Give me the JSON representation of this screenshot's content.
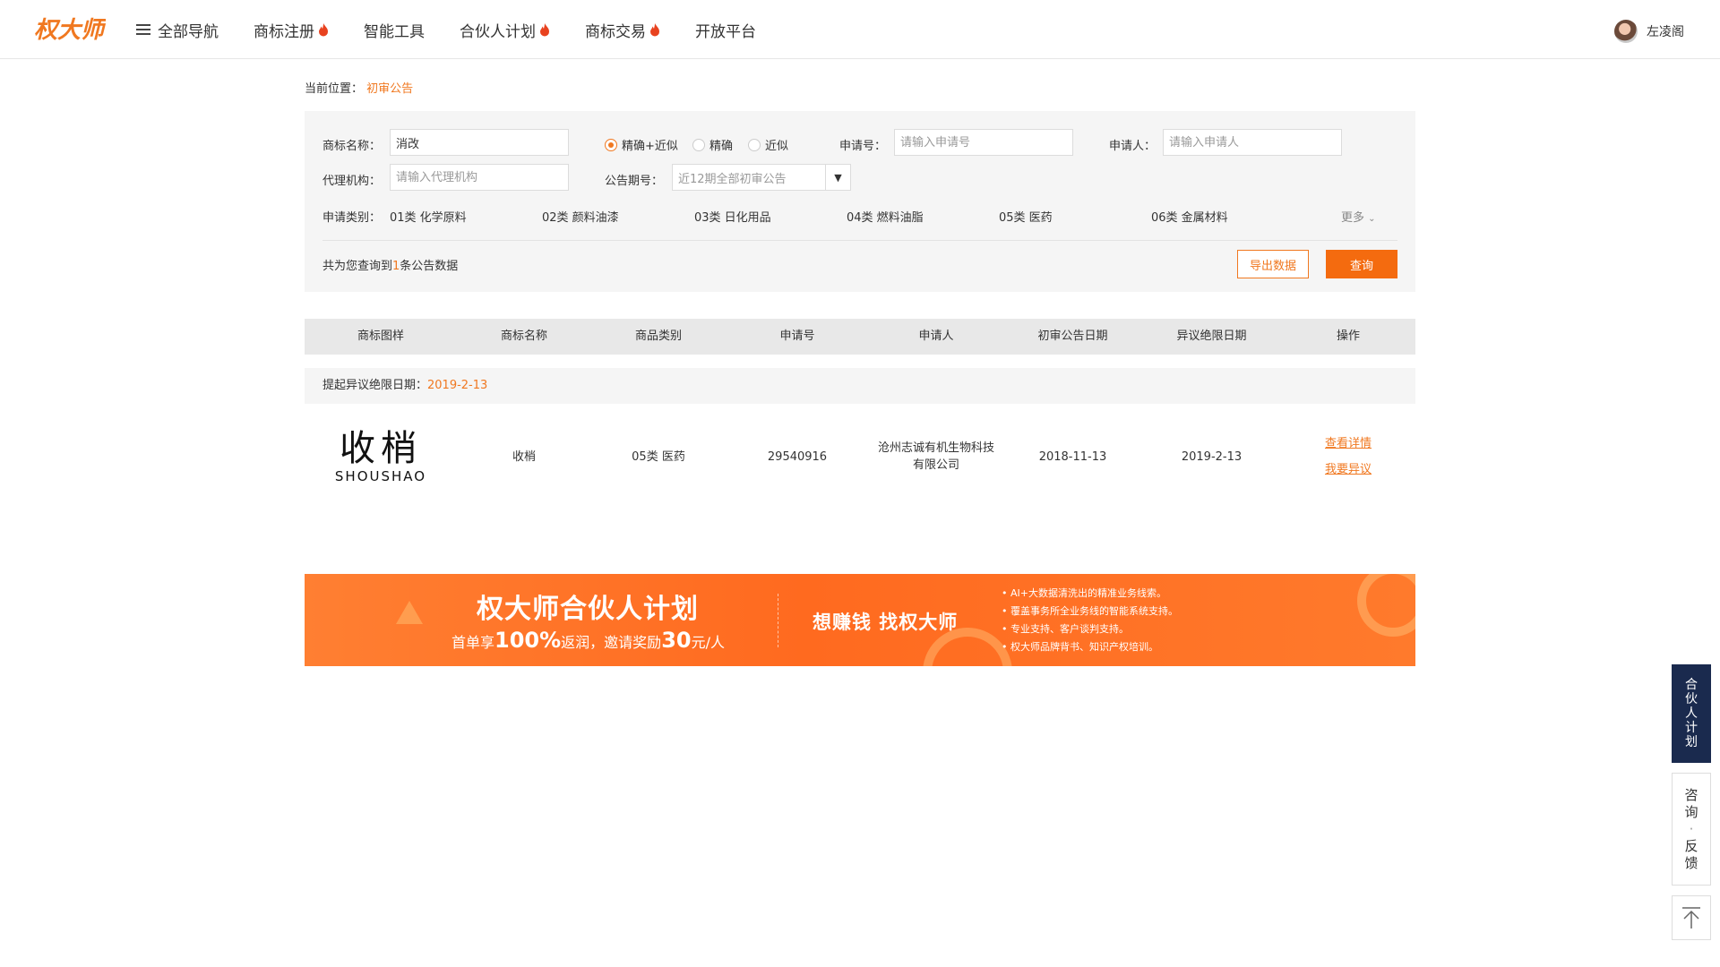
{
  "header": {
    "logo_text": "权大师",
    "nav": [
      {
        "label": "全部导航",
        "hot": false
      },
      {
        "label": "商标注册",
        "hot": true
      },
      {
        "label": "智能工具",
        "hot": false
      },
      {
        "label": "合伙人计划",
        "hot": true
      },
      {
        "label": "商标交易",
        "hot": true
      },
      {
        "label": "开放平台",
        "hot": false
      }
    ],
    "user_name": "左凌阁"
  },
  "breadcrumb": {
    "prefix": "当前位置：",
    "current": "初审公告"
  },
  "search": {
    "trademark_label": "商标名称：",
    "trademark_value": "消改",
    "match_options": [
      "精确+近似",
      "精确",
      "近似"
    ],
    "match_selected": "精确+近似",
    "appno_label": "申请号：",
    "appno_placeholder": "请输入申请号",
    "applicant_label": "申请人：",
    "applicant_placeholder": "请输入申请人",
    "agent_label": "代理机构：",
    "agent_placeholder": "请输入代理机构",
    "issue_label": "公告期号：",
    "issue_value": "近12期全部初审公告",
    "category_label": "申请类别：",
    "categories": [
      "01类 化学原料",
      "02类 颜料油漆",
      "03类 日化用品",
      "04类 燃料油脂",
      "05类 医药",
      "06类 金属材料"
    ],
    "more_label": "更多",
    "count_prefix": "共为您查询到",
    "count_value": "1",
    "count_suffix": "条公告数据",
    "export_label": "导出数据",
    "query_label": "查询"
  },
  "table": {
    "columns": [
      "商标图样",
      "商标名称",
      "商品类别",
      "申请号",
      "申请人",
      "初审公告日期",
      "异议绝限日期",
      "操作"
    ],
    "group_label": "提起异议绝限日期：",
    "group_date": "2019-2-13",
    "rows": [
      {
        "logo_cn": "收梢",
        "logo_en": "SHOUSHAO",
        "name": "收梢",
        "category": "05类 医药",
        "app_no": "29540916",
        "applicant_line1": "沧州志诚有机生物科技",
        "applicant_line2": "有限公司",
        "pub_date": "2018-11-13",
        "deadline": "2019-2-13",
        "action_detail": "查看详情",
        "action_object": "我要异议"
      }
    ]
  },
  "banner": {
    "title": "权大师合伙人计划",
    "sub_a": "首单享",
    "sub_b": "100%",
    "sub_c": "返润，邀请奖励",
    "sub_d": "30",
    "sub_e": "元/人",
    "middle": "想赚钱 找权大师",
    "points": [
      "AI+大数据清洗出的精准业务线索。",
      "覆盖事务所全业务线的智能系统支持。",
      "专业支持、客户谈判支持。",
      "权大师品牌背书、知识产权培训。"
    ]
  },
  "side": {
    "partner_chars": [
      "合",
      "伙",
      "人",
      "计",
      "划"
    ],
    "consult_chars": [
      "咨",
      "询",
      "·",
      "反",
      "馈"
    ]
  },
  "colors": {
    "accent": "#f07820",
    "button": "#f46b0f",
    "side_dark": "#1a2a4e"
  }
}
